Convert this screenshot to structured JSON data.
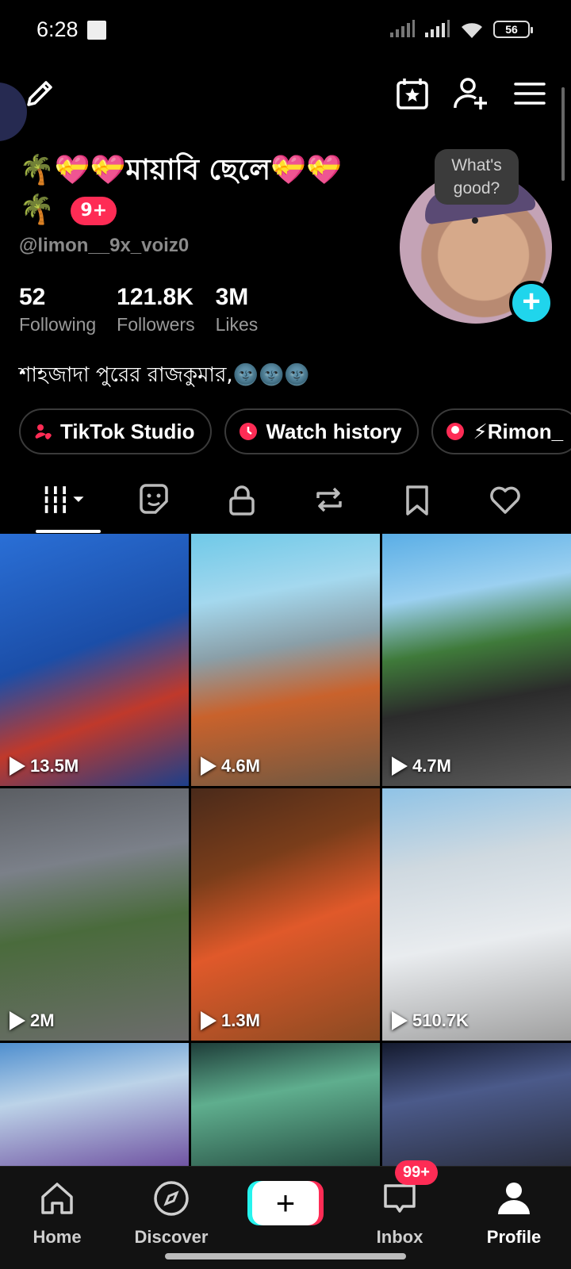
{
  "status_bar": {
    "time": "6:28",
    "battery": "56"
  },
  "profile": {
    "display_name": "🌴💝💝মায়াবি ছেলে💝💝🌴",
    "notification_badge": "9+",
    "username": "@limon__9x_voiz0",
    "bubble_text": "What's good?",
    "stats": [
      {
        "value": "52",
        "label": "Following"
      },
      {
        "value": "121.8K",
        "label": "Followers"
      },
      {
        "value": "3M",
        "label": "Likes"
      }
    ],
    "bio": "শাহজাদা পুরের রাজকুমার,🌚🌚🌚"
  },
  "chips": [
    {
      "label": "TikTok Studio",
      "color": "#fe2c55"
    },
    {
      "label": "Watch history",
      "color": "#fe2c55"
    },
    {
      "label": "⚡Rimon_",
      "color": "#fe2c55"
    }
  ],
  "tabs": [
    "videos-tab",
    "sticker-tab",
    "private-tab",
    "repost-tab",
    "saved-tab",
    "liked-tab"
  ],
  "videos": [
    {
      "views": "13.5M",
      "bg": "linear-gradient(160deg,#2a6fd6 0%,#1b4ea8 45%,#c0392b 70%,#1d3f8a 100%)"
    },
    {
      "views": "4.6M",
      "bg": "linear-gradient(170deg,#6fc9e8 0%,#a4d8ee 25%,#8a9fa8 45%,#c9622c 65%,#6e5842 100%)"
    },
    {
      "views": "4.7M",
      "bg": "linear-gradient(170deg,#5aaee6 0%,#9bd0f0 25%,#3f7a3a 45%,#2b2b2b 65%,#5a5a5a 100%)"
    },
    {
      "views": "2M",
      "bg": "linear-gradient(170deg,#5b5e63 0%,#7b8089 30%,#4a6b3c 55%,#6c6c6c 100%)"
    },
    {
      "views": "1.3M",
      "bg": "linear-gradient(160deg,#4a2a1a 0%,#7a3d1a 30%,#e0592a 55%,#8a4a22 100%)"
    },
    {
      "views": "510.7K",
      "bg": "linear-gradient(170deg,#8fc3e6 0%,#cfd9e0 30%,#e9ecef 60%,#a0a0a0 100%)"
    },
    {
      "views": "",
      "bg": "linear-gradient(170deg,#4f8fcf 0%,#bcd3e8 40%,#6d4fa0 100%)"
    },
    {
      "views": "",
      "bg": "linear-gradient(170deg,#1e3d39 0%,#5fae8e 40%,#244a3f 100%)"
    },
    {
      "views": "",
      "bg": "linear-gradient(170deg,#141a2e 0%,#4b5a8a 40%,#2a2e3e 100%)"
    }
  ],
  "nav": {
    "home": "Home",
    "discover": "Discover",
    "inbox": "Inbox",
    "inbox_badge": "99+",
    "profile": "Profile",
    "create": "+"
  }
}
